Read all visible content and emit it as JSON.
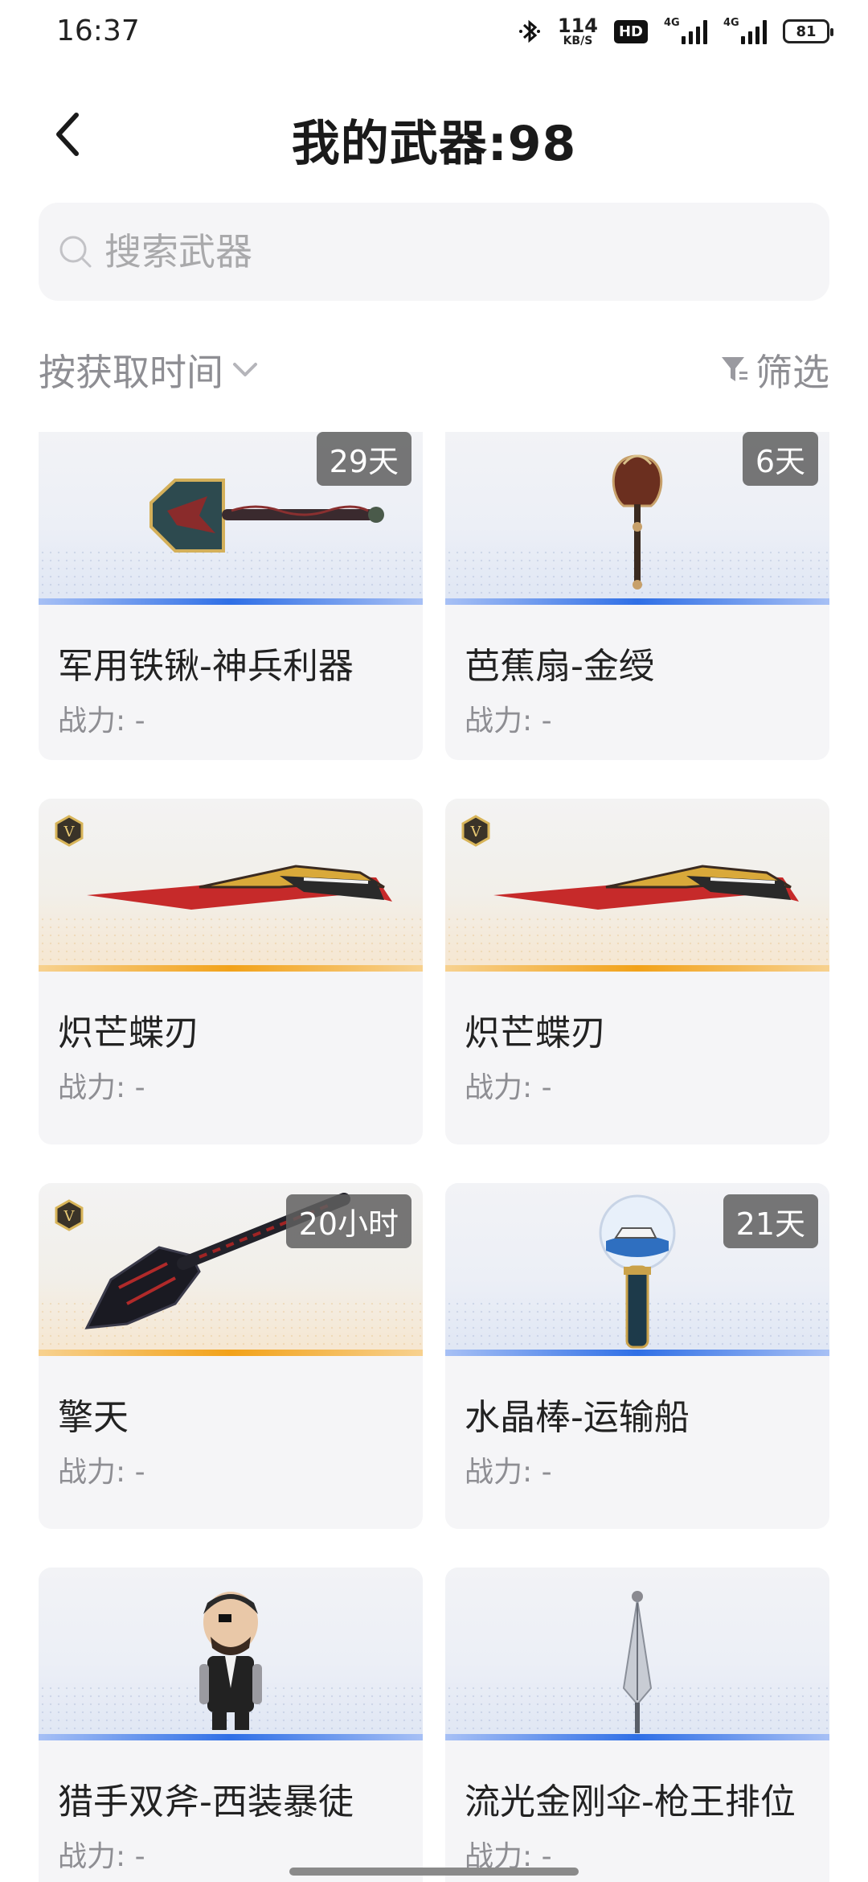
{
  "status_bar": {
    "time": "16:37",
    "net_speed_value": "114",
    "net_speed_unit": "KB/S",
    "hd_badge": "HD",
    "sim1_tag": "4G",
    "sim2_tag": "4G",
    "battery": "81"
  },
  "header": {
    "title": "我的武器:98"
  },
  "search": {
    "placeholder": "搜索武器"
  },
  "toolbar": {
    "sort_label": "按获取时间",
    "filter_label": "筛选"
  },
  "cards": [
    {
      "name": "军用铁锹-神兵利器",
      "power": "战力: -",
      "badge": "29天",
      "rarity": "blue",
      "vip": false,
      "icon": "shovel-icon"
    },
    {
      "name": "芭蕉扇-金绶",
      "power": "战力: -",
      "badge": "6天",
      "rarity": "blue",
      "vip": false,
      "icon": "fan-icon"
    },
    {
      "name": "炽芒蝶刃",
      "power": "战力: -",
      "badge": "",
      "rarity": "gold",
      "vip": true,
      "icon": "butterfly-blade-icon"
    },
    {
      "name": "炽芒蝶刃",
      "power": "战力: -",
      "badge": "",
      "rarity": "gold",
      "vip": true,
      "icon": "butterfly-blade-icon"
    },
    {
      "name": "擎天",
      "power": "战力: -",
      "badge": "20小时",
      "rarity": "gold",
      "vip": true,
      "icon": "dark-spade-icon"
    },
    {
      "name": "水晶棒-运输船",
      "power": "战力: -",
      "badge": "21天",
      "rarity": "blue",
      "vip": false,
      "icon": "crystal-wand-icon"
    },
    {
      "name": "猎手双斧-西装暴徒",
      "power": "战力: -",
      "badge": "",
      "rarity": "blue",
      "vip": false,
      "icon": "figure-icon"
    },
    {
      "name": "流光金刚伞-枪王排位",
      "power": "战力: -",
      "badge": "",
      "rarity": "blue",
      "vip": false,
      "icon": "umbrella-icon"
    }
  ],
  "colors": {
    "accent_blue": "#2f6fe6",
    "accent_gold": "#f2a21a",
    "card_bg": "#f5f5f7",
    "muted_text": "#8e8e93"
  }
}
